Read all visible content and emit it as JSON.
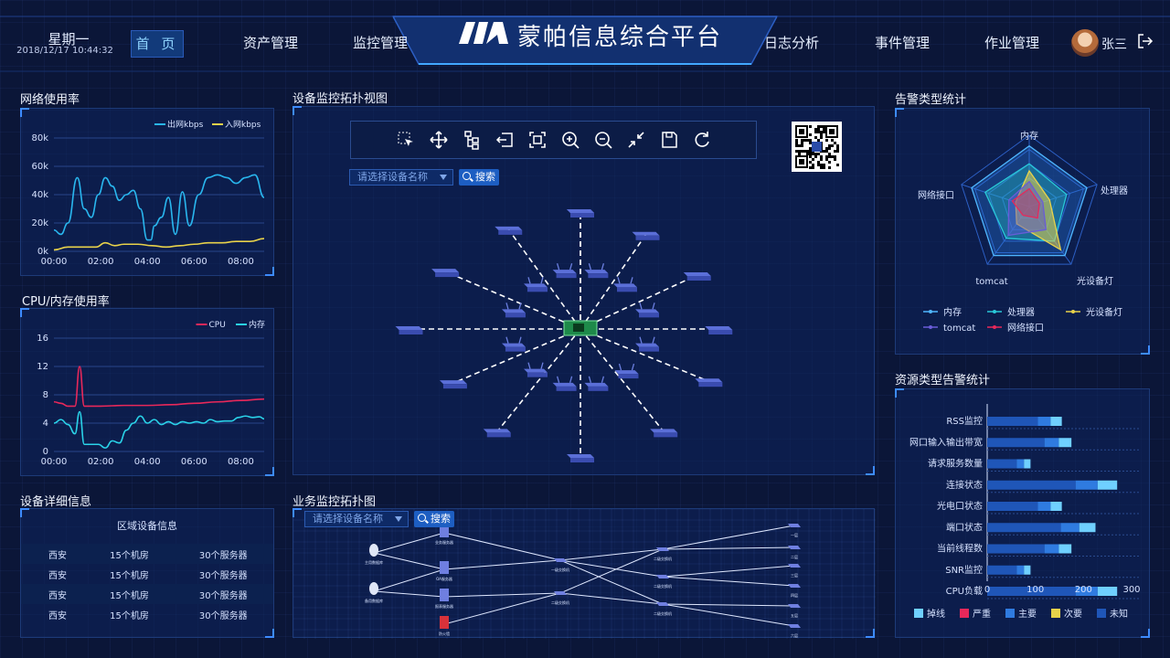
{
  "header": {
    "weekday": "星期一",
    "datetime": "2018/12/17 10:44:32",
    "home": "首 页",
    "nav_left": [
      "资产管理",
      "监控管理"
    ],
    "title": "蒙帕信息综合平台",
    "nav_right": [
      "日志分析",
      "事件管理",
      "作业管理"
    ],
    "user": "张三"
  },
  "panels": {
    "network": "网络使用率",
    "cpu": "CPU/内存使用率",
    "device_detail": "设备详细信息",
    "topo": "设备监控拓扑视图",
    "biz_topo": "业务监控拓扑图",
    "alert_type": "告警类型统计",
    "resource_alert": "资源类型告警统计"
  },
  "search": {
    "placeholder": "请选择设备名称",
    "button": "搜索"
  },
  "device_table": {
    "header": "区域设备信息",
    "rows": [
      [
        "西安",
        "15个机房",
        "30个服务器"
      ],
      [
        "西安",
        "15个机房",
        "30个服务器"
      ],
      [
        "西安",
        "15个机房",
        "30个服务器"
      ],
      [
        "西安",
        "15个机房",
        "30个服务器"
      ]
    ]
  },
  "biz_labels": {
    "db1": "主用数据库",
    "db2": "备用数据库",
    "srv1": "业务服务器",
    "srv2": "OA服务器",
    "srv3": "报表服务器",
    "fw": "防火墙",
    "sw1": "一级交换机",
    "sw2": "二级交换机",
    "sw3": "二级交换机",
    "sw4": "二级交换机",
    "sw5": "二级交换机",
    "f1": "一层",
    "f2": "二层",
    "f3": "三层",
    "f4": "四层",
    "f5": "五层",
    "f6": "六层"
  },
  "colors": {
    "out": "#29b6ee",
    "in": "#e8d24a",
    "cpu": "#e8285a",
    "mem": "#2ad2e8",
    "accent": "#3d8bff",
    "bg": "#0b1638"
  },
  "icons": [
    "select-icon",
    "move-icon",
    "tree-icon",
    "export-icon",
    "fit-icon",
    "zoom-in-icon",
    "zoom-out-icon",
    "shrink-icon",
    "save-icon",
    "refresh-icon"
  ],
  "chart_data": [
    {
      "type": "line",
      "legend": [
        "出网kbps",
        "入网kbps"
      ],
      "x_ticks": [
        "00:00",
        "02:00",
        "04:00",
        "06:00",
        "08:00"
      ],
      "y_ticks": [
        "0k",
        "20k",
        "40k",
        "60k",
        "80k"
      ],
      "ylim": [
        0,
        80
      ],
      "xlim": [
        0,
        9
      ],
      "series": [
        {
          "name": "出网kbps",
          "x": [
            0,
            0.3,
            0.6,
            1.0,
            1.3,
            1.6,
            1.9,
            2.2,
            2.5,
            2.8,
            3.1,
            3.4,
            3.7,
            4.0,
            4.15,
            4.3,
            4.6,
            4.9,
            5.2,
            5.5,
            5.8,
            6.2,
            6.6,
            7.0,
            7.4,
            7.8,
            8.2,
            8.6,
            9.0
          ],
          "values": [
            15,
            12,
            20,
            52,
            30,
            24,
            40,
            52,
            46,
            36,
            40,
            43,
            30,
            8,
            8,
            18,
            24,
            38,
            12,
            42,
            18,
            40,
            52,
            54,
            52,
            48,
            52,
            54,
            38
          ]
        },
        {
          "name": "入网kbps",
          "x": [
            0,
            0.6,
            1.2,
            1.8,
            2.2,
            2.6,
            3.0,
            3.6,
            4.2,
            4.8,
            5.4,
            6.0,
            6.6,
            7.2,
            7.8,
            8.4,
            9.0
          ],
          "values": [
            1,
            3,
            3,
            3,
            6,
            4,
            5,
            5,
            4,
            3,
            4,
            5,
            6,
            6,
            7,
            7,
            9
          ]
        }
      ]
    },
    {
      "type": "line",
      "legend": [
        "CPU",
        "内存"
      ],
      "x_ticks": [
        "00:00",
        "02:00",
        "04:00",
        "06:00",
        "08:00"
      ],
      "y_ticks": [
        "0",
        "4",
        "8",
        "12",
        "16"
      ],
      "ylim": [
        0,
        16
      ],
      "xlim": [
        0,
        9
      ],
      "series": [
        {
          "name": "CPU",
          "x": [
            0,
            0.3,
            0.6,
            0.9,
            1.1,
            1.3,
            1.5,
            2.0,
            3.0,
            4.0,
            5.0,
            6.0,
            7.0,
            8.0,
            9.0
          ],
          "values": [
            7,
            6.8,
            6.4,
            6.4,
            12,
            6.4,
            6.4,
            6.4,
            6.5,
            6.5,
            6.6,
            6.8,
            7.0,
            7.2,
            7.4
          ]
        },
        {
          "name": "内存",
          "x": [
            0,
            0.3,
            0.6,
            0.9,
            1.1,
            1.3,
            1.6,
            1.9,
            2.2,
            2.5,
            2.8,
            3.1,
            3.4,
            3.7,
            4.0,
            4.3,
            4.6,
            4.9,
            5.2,
            5.5,
            5.8,
            6.1,
            6.4,
            6.7,
            7.0,
            7.3,
            7.6,
            7.9,
            8.2,
            8.5,
            8.8,
            9.0
          ],
          "values": [
            4,
            4.5,
            3.8,
            2.5,
            5.6,
            1,
            1,
            1,
            0.5,
            1.5,
            1.2,
            3,
            4,
            5,
            4,
            4.5,
            3.8,
            4.2,
            3.8,
            4.2,
            4,
            4.2,
            4,
            4.5,
            4.2,
            4.3,
            4.3,
            4.8,
            5,
            4.8,
            4.9,
            4.6
          ]
        }
      ]
    },
    {
      "type": "radar",
      "indicators": [
        "内存",
        "处理器",
        "光设备灯",
        "tomcat",
        "网络接口"
      ],
      "legend": [
        "内存",
        "处理器",
        "光设备灯",
        "tomcat",
        "网络接口"
      ],
      "series": [
        {
          "name": "内存",
          "values": [
            0.85,
            0.85,
            0.85,
            0.85,
            0.85
          ]
        },
        {
          "name": "处理器",
          "values": [
            0.6,
            0.55,
            0.6,
            0.55,
            0.65
          ]
        },
        {
          "name": "光设备灯",
          "values": [
            0.5,
            0.3,
            0.75,
            0.3,
            0.2
          ]
        },
        {
          "name": "tomcat",
          "values": [
            0.35,
            0.2,
            0.4,
            0.5,
            0.3
          ]
        },
        {
          "name": "网络接口",
          "values": [
            0.25,
            0.15,
            0.2,
            0.15,
            0.25
          ]
        }
      ]
    },
    {
      "type": "bar",
      "orientation": "horizontal",
      "categories": [
        "RSS监控",
        "网口输入输出带宽",
        "请求服务数量",
        "连接状态",
        "光电口状态",
        "端口状态",
        "当前线程数",
        "SNR监控",
        "CPU负载"
      ],
      "xlim": [
        0,
        300
      ],
      "x_ticks": [
        "0",
        "100",
        "200",
        "300"
      ],
      "legend": [
        "掉线",
        "严重",
        "主要",
        "次要",
        "未知"
      ],
      "totals": [
        155,
        175,
        90,
        270,
        155,
        225,
        175,
        90,
        270
      ]
    }
  ]
}
